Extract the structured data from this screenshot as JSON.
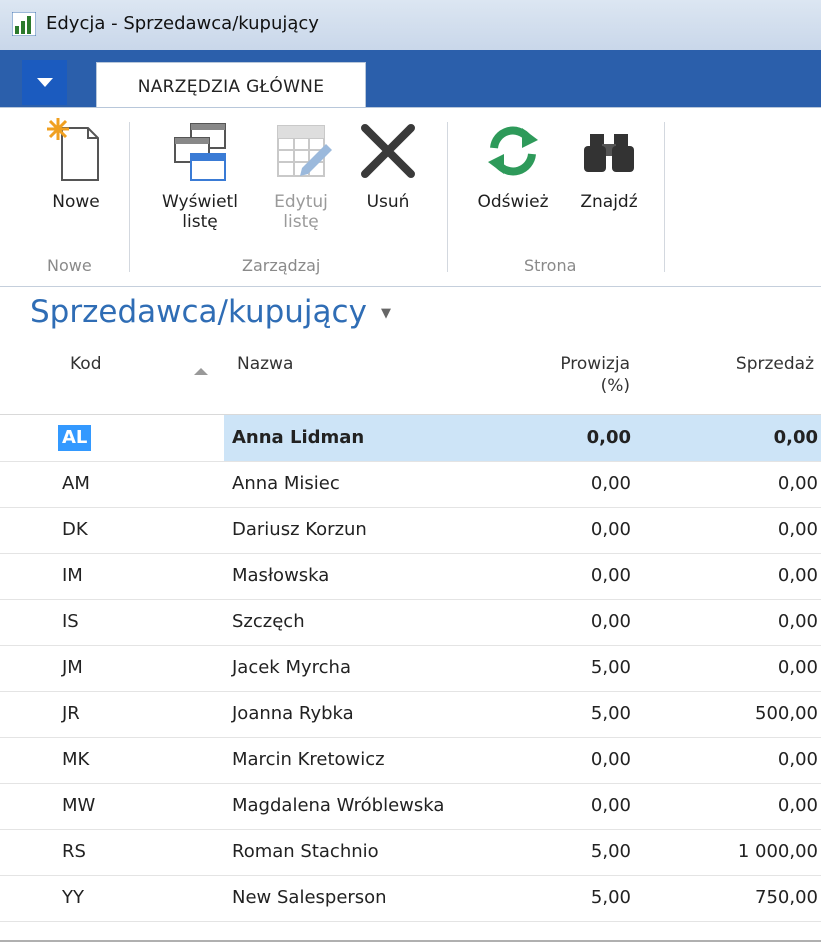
{
  "window": {
    "title": "Edycja - Sprzedawca/kupujący"
  },
  "ribbon": {
    "tab": "NARZĘDZIA GŁÓWNE",
    "buttons": {
      "new": "Nowe",
      "show_list_1": "Wyświetl",
      "show_list_2": "listę",
      "edit_list_1": "Edytuj",
      "edit_list_2": "listę",
      "delete": "Usuń",
      "refresh": "Odśwież",
      "find": "Znajdź"
    },
    "groups": {
      "new": "Nowe",
      "manage": "Zarządzaj",
      "page": "Strona"
    }
  },
  "page": {
    "title": "Sprzedawca/kupujący"
  },
  "columns": {
    "code": "Kod",
    "name": "Nazwa",
    "commission_1": "Prowizja",
    "commission_2": "(%)",
    "sales": "Sprzedaż"
  },
  "rows": [
    {
      "code": "AL",
      "name": "Anna Lidman",
      "commission": "0,00",
      "sales": "0,00"
    },
    {
      "code": "AM",
      "name": "Anna Misiec",
      "commission": "0,00",
      "sales": "0,00"
    },
    {
      "code": "DK",
      "name": "Dariusz Korzun",
      "commission": "0,00",
      "sales": "0,00"
    },
    {
      "code": "IM",
      "name": "Masłowska",
      "commission": "0,00",
      "sales": "0,00"
    },
    {
      "code": "IS",
      "name": "Szczęch",
      "commission": "0,00",
      "sales": "0,00"
    },
    {
      "code": "JM",
      "name": "Jacek Myrcha",
      "commission": "5,00",
      "sales": "0,00"
    },
    {
      "code": "JR",
      "name": "Joanna Rybka",
      "commission": "5,00",
      "sales": "500,00"
    },
    {
      "code": "MK",
      "name": "Marcin Kretowicz",
      "commission": "0,00",
      "sales": "0,00"
    },
    {
      "code": "MW",
      "name": "Magdalena Wróblewska",
      "commission": "0,00",
      "sales": "0,00"
    },
    {
      "code": "RS",
      "name": "Roman Stachnio",
      "commission": "5,00",
      "sales": "1 000,00"
    },
    {
      "code": "YY",
      "name": "New Salesperson",
      "commission": "5,00",
      "sales": "750,00"
    }
  ],
  "colors": {
    "accent": "#2f6db5",
    "selection": "#cde4f7",
    "highlight": "#3399ff"
  }
}
